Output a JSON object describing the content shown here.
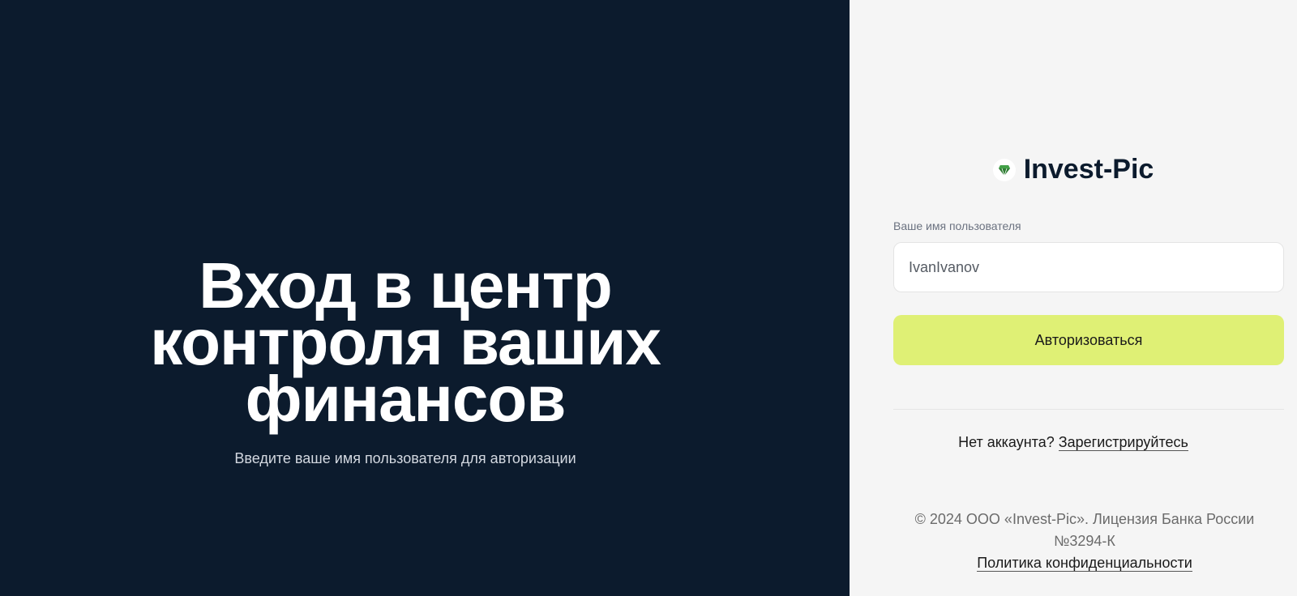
{
  "hero": {
    "title_line1": "Вход в центр",
    "title_line2": "контроля ваших",
    "title_line3": "финансов",
    "subtitle": "Введите ваше имя пользователя для авторизации"
  },
  "brand": {
    "name": "Invest-Pic",
    "icon": "diamond-icon",
    "icon_color": "#2e7d32"
  },
  "form": {
    "username_label": "Ваше имя пользователя",
    "username_value": "IvanIvanov",
    "submit_label": "Авторизоваться"
  },
  "register": {
    "prompt": "Нет аккаунта?",
    "link_label": "Зарегистрируйтесь"
  },
  "footer": {
    "copyright_line1": "© 2024 ООО «Invest-Pic». Лицензия Банка России",
    "copyright_line2": "№3294-К",
    "privacy_link": "Политика конфиденциальности"
  },
  "colors": {
    "hero_bg": "#0c1b2d",
    "panel_bg": "#f5f5f5",
    "accent": "#dff075"
  }
}
